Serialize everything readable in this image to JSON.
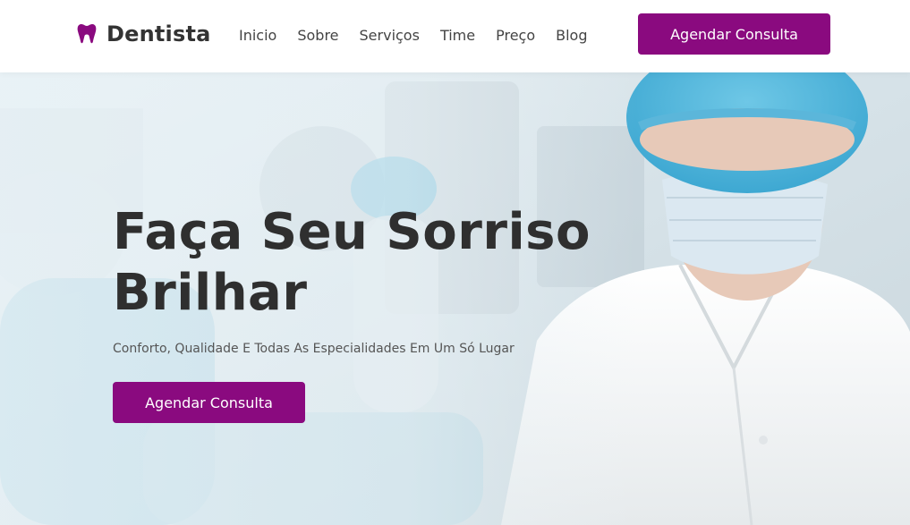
{
  "brand": {
    "name": "Dentista",
    "icon": "tooth-icon",
    "icon_color": "#8a0a7f"
  },
  "nav": {
    "items": [
      {
        "label": "Inicio"
      },
      {
        "label": "Sobre"
      },
      {
        "label": "Serviços"
      },
      {
        "label": "Time"
      },
      {
        "label": "Preço"
      },
      {
        "label": "Blog"
      }
    ]
  },
  "header_cta": {
    "label": "Agendar Consulta"
  },
  "hero": {
    "title_line1": "Faça Seu Sorriso",
    "title_line2": "Brilhar",
    "subtitle": "Conforto, Qualidade E Todas As Especialidades Em Um Só Lugar",
    "cta_label": "Agendar Consulta",
    "image": "dental-professionals-photo"
  },
  "colors": {
    "accent": "#8a0a7f",
    "text_dark": "#2f2f2f"
  }
}
